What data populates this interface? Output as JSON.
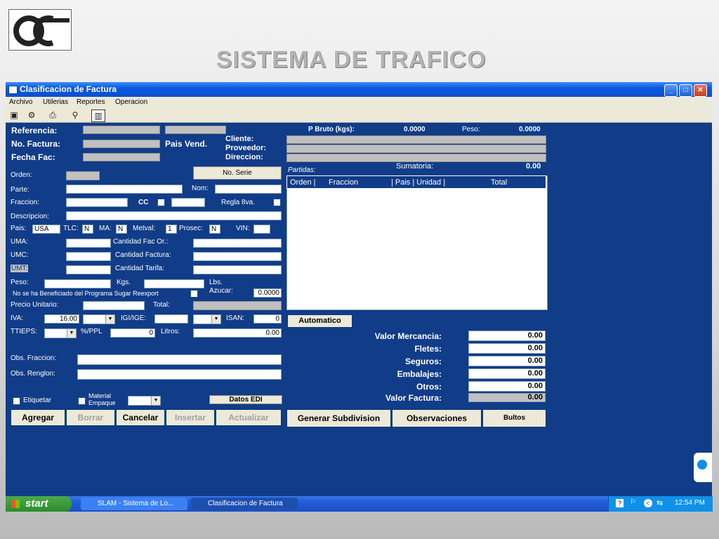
{
  "slide": {
    "title": "SISTEMA DE TRAFICO"
  },
  "window": {
    "title": "Clasificacion de Factura"
  },
  "menu": [
    "Archivo",
    "Utilerias",
    "Reportes",
    "Operacion"
  ],
  "form": {
    "referencia": "Referencia:",
    "no_factura": "No. Factura:",
    "pais_vend": "Pais Vend.",
    "fecha_fac": "Fecha Fac:",
    "cliente": "Cliente:",
    "proveedor": "Proveedor:",
    "direccion": "Direccion:",
    "orden": "Orden:",
    "no_serie": "No. Serie",
    "parte": "Parte:",
    "nom": "Nom:",
    "fraccion": "Fraccion:",
    "cc": "CC",
    "regla": "Regla 8va.",
    "descripcion": "Descripcion:",
    "pais": "Pais:",
    "pais_value": "USA",
    "tlc": "TLC:",
    "tlc_value": "N",
    "ma": "MA:",
    "ma_value": "N",
    "metval": "Metval:",
    "metval_value": "1",
    "prosec": "Prosec:",
    "prosec_value": "N",
    "vin": "VIN:",
    "uma": "UMA:",
    "cant_fac_or": "Cantidad Fac Or.:",
    "umc": "UMC:",
    "cant_factura": "Cantidad Factura:",
    "umt": "UMT:",
    "cant_tarifa": "Cantidad Tarifa:",
    "peso": "Peso:",
    "kgs": "Kgs.",
    "lbs": "Lbs.",
    "azucar": "Azucar:",
    "azucar_value": "0.0000",
    "sugar_note": "No se ha Beneficiado del Programa Sugar Reexport",
    "precio_unitario": "Precio Unitario:",
    "total": "Total:",
    "iva": "IVA:",
    "iva_value": "16.00",
    "igi": "IGI/IGE:",
    "isan": "ISAN:",
    "isan_value": "0",
    "ttieps": "TTIEPS:",
    "ppl": "%/PPL",
    "ppl_value": "0",
    "litros": "Litros:",
    "litros_value": "0.00",
    "obs_fraccion": "Obs. Fraccion:",
    "obs_renglon": "Obs. Renglon:",
    "etiquetar": "Etiquetar",
    "material_empaque": "Material Empaque",
    "datos_edi": "Datos EDI"
  },
  "buttons": {
    "agregar": "Agregar",
    "borrar": "Borrar",
    "cancelar": "Cancelar",
    "insertar": "Insertar",
    "actualizar": "Actualizar",
    "automatico": "Automatico",
    "generar": "Generar Subdivision",
    "observaciones": "Observaciones",
    "bultos": "Bultos"
  },
  "summary": {
    "p_bruto_label": "P Bruto (kgs):",
    "p_bruto_value": "0.0000",
    "peso_label": "Peso:",
    "peso_value": "0.0000",
    "partidas": "Partidas:",
    "sumatoria_label": "Sumatoria:",
    "sumatoria_value": "0.00",
    "columns": [
      "Orden |",
      "Fraccion",
      "| Pais | Unidad |",
      "Total"
    ]
  },
  "totals": [
    {
      "label": "Valor Mercancia:",
      "value": "0.00"
    },
    {
      "label": "Fletes:",
      "value": "0.00"
    },
    {
      "label": "Seguros:",
      "value": "0.00"
    },
    {
      "label": "Embalajes:",
      "value": "0.00"
    },
    {
      "label": "Otros:",
      "value": "0.00"
    },
    {
      "label": "Valor Factura:",
      "value": "0.00"
    }
  ],
  "taskbar": {
    "start": "start",
    "tasks": [
      "SLAM - Sistema de Lo...",
      "Clasificacion de Factura"
    ],
    "clock": "12:54 PM"
  }
}
